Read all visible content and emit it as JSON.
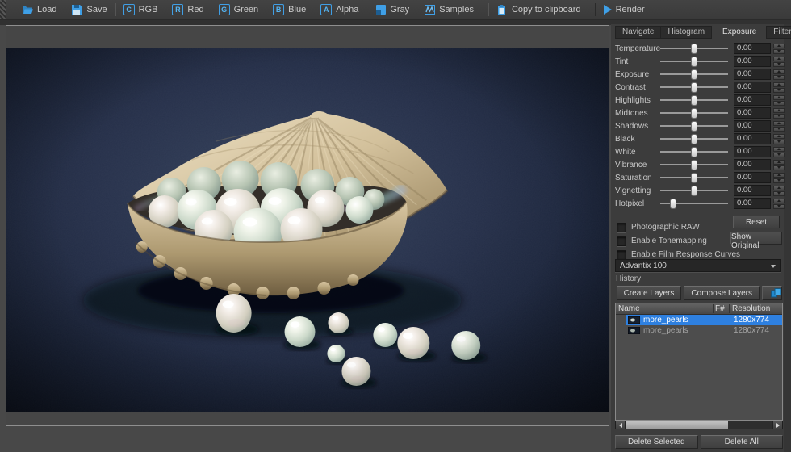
{
  "toolbar": {
    "items": [
      {
        "label": "Load",
        "icon": "folder-open-icon"
      },
      {
        "label": "Save",
        "icon": "save-icon"
      },
      {
        "label": "RGB",
        "icon_letter": "C"
      },
      {
        "label": "Red",
        "icon_letter": "R"
      },
      {
        "label": "Green",
        "icon_letter": "G"
      },
      {
        "label": "Blue",
        "icon_letter": "B"
      },
      {
        "label": "Alpha",
        "icon_letter": "A"
      },
      {
        "label": "Gray",
        "icon": "gray-swatch-icon"
      },
      {
        "label": "Samples",
        "icon": "samples-waveform-icon"
      },
      {
        "label": "Copy to clipboard",
        "icon": "clipboard-icon"
      },
      {
        "label": "Render",
        "icon": "play-icon"
      }
    ]
  },
  "panel": {
    "tabs": [
      {
        "label": "Navigate",
        "active": false
      },
      {
        "label": "Histogram",
        "active": false
      },
      {
        "label": "Exposure",
        "active": true
      },
      {
        "label": "Filter",
        "active": false
      }
    ],
    "sliders": [
      {
        "label": "Temperature",
        "value": "0.00",
        "position_pct": 50
      },
      {
        "label": "Tint",
        "value": "0.00",
        "position_pct": 50
      },
      {
        "label": "Exposure",
        "value": "0.00",
        "position_pct": 50
      },
      {
        "label": "Contrast",
        "value": "0.00",
        "position_pct": 50
      },
      {
        "label": "Highlights",
        "value": "0.00",
        "position_pct": 50
      },
      {
        "label": "Midtones",
        "value": "0.00",
        "position_pct": 50
      },
      {
        "label": "Shadows",
        "value": "0.00",
        "position_pct": 50
      },
      {
        "label": "Black",
        "value": "0.00",
        "position_pct": 50
      },
      {
        "label": "White",
        "value": "0.00",
        "position_pct": 50
      },
      {
        "label": "Vibrance",
        "value": "0.00",
        "position_pct": 50
      },
      {
        "label": "Saturation",
        "value": "0.00",
        "position_pct": 50
      },
      {
        "label": "Vignetting",
        "value": "0.00",
        "position_pct": 50
      },
      {
        "label": "Hotpixel",
        "value": "0.00",
        "position_pct": 21
      }
    ],
    "checkboxes": [
      {
        "label": "Photographic RAW",
        "checked": false
      },
      {
        "label": "Enable Tonemapping",
        "checked": false
      },
      {
        "label": "Enable Film Response Curves",
        "checked": false
      }
    ],
    "buttons": {
      "reset": "Reset",
      "show_original": "Show Original",
      "create_layers": "Create Layers",
      "compose_layers": "Compose Layers",
      "delete_selected": "Delete Selected",
      "delete_all": "Delete All"
    },
    "film_response_dropdown": {
      "value": "Advantix 100"
    },
    "history": {
      "title": "History",
      "columns": [
        "Name",
        "F#",
        "Resolution"
      ],
      "rows": [
        {
          "name": "more_pearls",
          "f_number": "",
          "resolution": "1280x774",
          "selected": true
        },
        {
          "name": "more_pearls",
          "f_number": "",
          "resolution": "1280x774",
          "selected": false
        }
      ]
    }
  },
  "colors": {
    "icon_blue": "#3f9fe6",
    "selection_blue": "#2e80e0",
    "panel_background": "#3c3c3c"
  }
}
